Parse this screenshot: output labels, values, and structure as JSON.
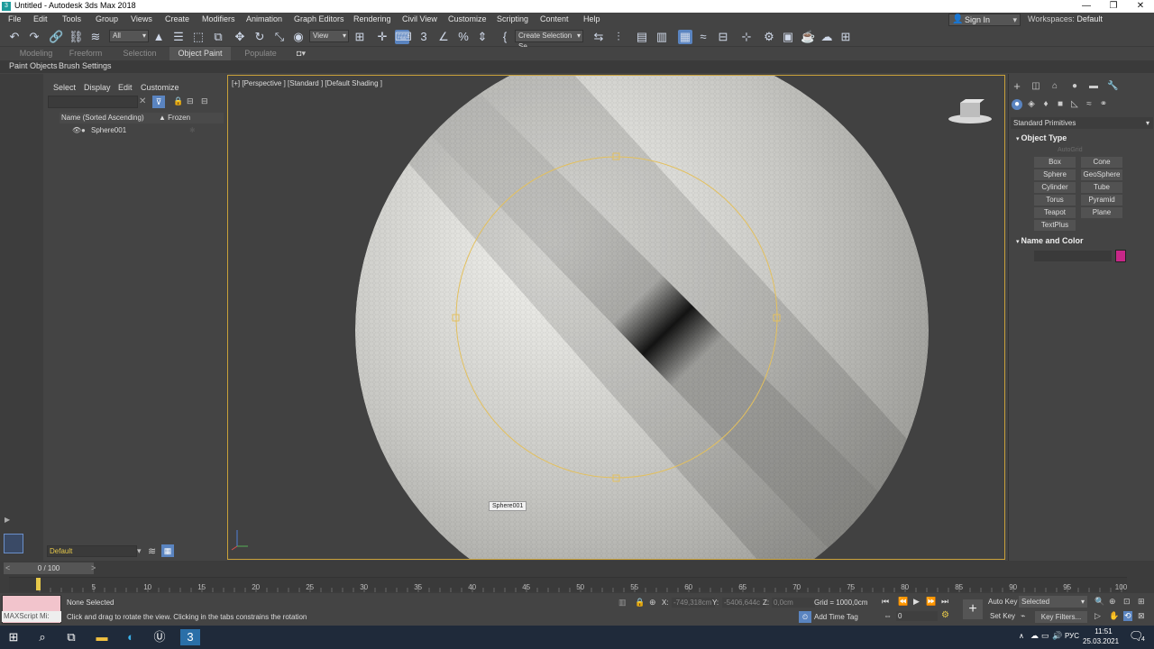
{
  "window": {
    "title": "Untitled - Autodesk 3ds Max 2018",
    "app_icon": "3"
  },
  "menu": {
    "items": [
      "File",
      "Edit",
      "Tools",
      "Group",
      "Views",
      "Create",
      "Modifiers",
      "Animation",
      "Graph Editors",
      "Rendering",
      "Civil View",
      "Customize",
      "Scripting",
      "Content",
      "Help"
    ],
    "sign_in": "Sign In",
    "workspaces_label": "Workspaces:",
    "workspaces_value": "Default"
  },
  "toolbar": {
    "filter_value": "All",
    "ref_coord_value": "View",
    "selection_set_value": "Create Selection Se"
  },
  "ribbon": {
    "tabs": [
      "Modeling",
      "Freeform",
      "Selection",
      "Object Paint",
      "Populate"
    ],
    "active_tab": "Object Paint",
    "sub_items": [
      "Paint Objects",
      "Brush Settings"
    ]
  },
  "scene_explorer": {
    "menu": [
      "Select",
      "Display",
      "Edit",
      "Customize"
    ],
    "header_name": "Name (Sorted Ascending)",
    "header_frozen": "▲ Frozen",
    "object": "Sphere001",
    "layer": "Default"
  },
  "viewport": {
    "label": "[+] [Perspective ] [Standard ] [Default Shading ]",
    "object_tooltip": "Sphere001"
  },
  "command_panel": {
    "category": "Standard Primitives",
    "object_type_title": "Object Type",
    "autogrid": "AutoGrid",
    "buttons": [
      "Box",
      "Cone",
      "Sphere",
      "GeoSphere",
      "Cylinder",
      "Tube",
      "Torus",
      "Pyramid",
      "Teapot",
      "Plane",
      "TextPlus"
    ],
    "name_color_title": "Name and Color",
    "color": "#c82788"
  },
  "timeline": {
    "counter": "0 / 100",
    "ticks": [
      "5",
      "10",
      "15",
      "20",
      "25",
      "30",
      "35",
      "40",
      "45",
      "50",
      "55",
      "60",
      "65",
      "70",
      "75",
      "80",
      "85",
      "90",
      "95",
      "100"
    ]
  },
  "status": {
    "maxscript": "MAXScript Mi:",
    "line1": "None Selected",
    "line2": "Click and drag to rotate the view.  Clicking in the tabs constrains the rotation",
    "x_label": "X:",
    "x_value": "-749,318cm",
    "y_label": "Y:",
    "y_value": "-5406,644c",
    "z_label": "Z:",
    "z_value": "0,0cm",
    "grid": "Grid = 1000,0cm",
    "add_time_tag": "Add Time Tag",
    "auto_key": "Auto Key",
    "set_key": "Set Key",
    "selected": "Selected",
    "key_filters": "Key Filters...",
    "frame": "0"
  },
  "taskbar": {
    "lang": "РУС",
    "time": "11:51",
    "date": "25.03.2021",
    "notifications": "4"
  }
}
